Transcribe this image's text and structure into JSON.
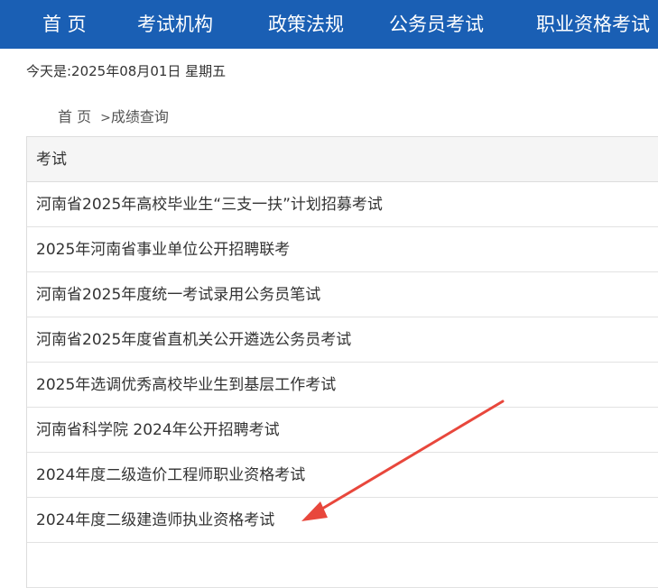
{
  "nav": {
    "items": [
      {
        "label": "首 页"
      },
      {
        "label": "考试机构"
      },
      {
        "label": "政策法规"
      },
      {
        "label": "公务员考试"
      },
      {
        "label": "职业资格考试"
      }
    ]
  },
  "date_text": "今天是:2025年08月01日 星期五",
  "breadcrumb": {
    "home": "首 页",
    "separator": ">",
    "current": "成绩查询"
  },
  "table": {
    "header": "考试",
    "rows": [
      "河南省2025年高校毕业生“三支一扶”计划招募考试",
      "2025年河南省事业单位公开招聘联考",
      "河南省2025年度统一考试录用公务员笔试",
      "河南省2025年度省直机关公开遴选公务员考试",
      "2025年选调优秀高校毕业生到基层工作考试",
      "河南省科学院 2024年公开招聘考试",
      "2024年度二级造价工程师职业资格考试",
      "2024年度二级建造师执业资格考试"
    ]
  },
  "colors": {
    "nav_bg": "#1a5fb4",
    "annotation_arrow": "#e8473c"
  }
}
